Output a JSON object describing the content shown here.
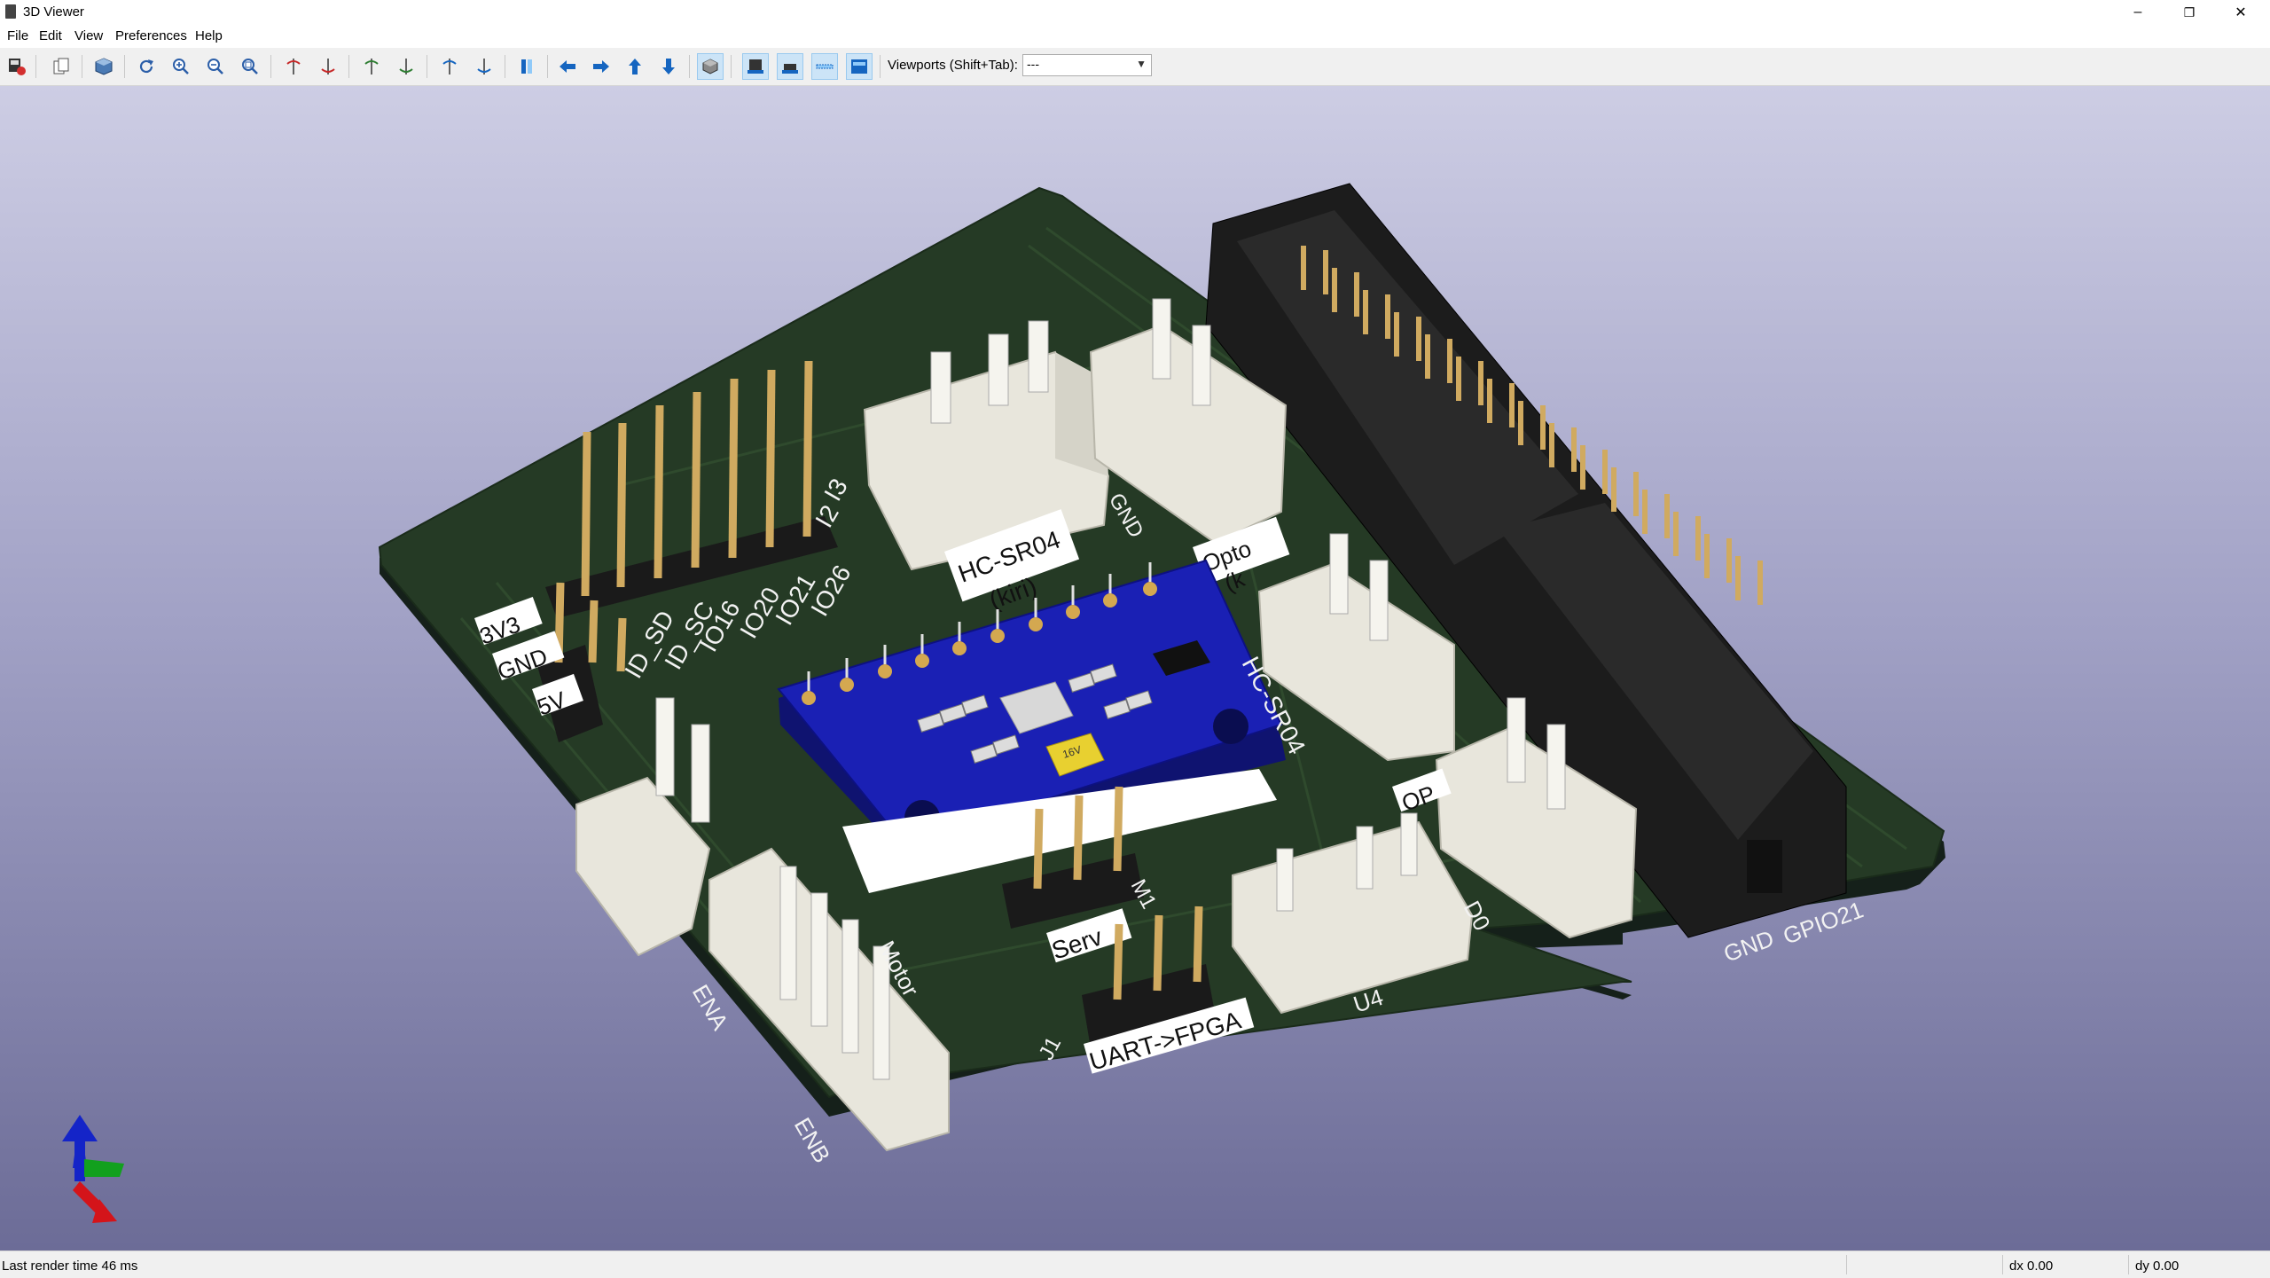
{
  "window": {
    "title": "3D Viewer",
    "controls": {
      "minimize": "–",
      "maximize": "❐",
      "close": "✕"
    }
  },
  "menu": {
    "items": [
      "File",
      "Edit",
      "View",
      "Preferences",
      "Help"
    ]
  },
  "toolbar": {
    "viewports_label": "Viewports (Shift+Tab):",
    "viewports_selected": "---",
    "icons": [
      "render-export-icon",
      "copy-image-icon",
      "raytrace-icon",
      "reload-icon",
      "zoom-in-icon",
      "zoom-out-icon",
      "zoom-fit-icon",
      "rotate-x-cw-icon",
      "rotate-x-ccw-icon",
      "rotate-y-cw-icon",
      "rotate-y-ccw-icon",
      "rotate-z-cw-icon",
      "rotate-z-ccw-icon",
      "flip-board-icon",
      "move-left-icon",
      "move-right-icon",
      "move-up-icon",
      "move-down-icon",
      "ortho-toggle-icon",
      "view-top-icon",
      "view-bottom-icon",
      "view-side-icon",
      "view-front-icon"
    ]
  },
  "board": {
    "header_labels": [
      "I2",
      "I3",
      "IO26",
      "IO21",
      "IO20",
      "IO16",
      "ID_SC",
      "ID_SD"
    ],
    "power_labels": [
      "3V3",
      "GND",
      "5V"
    ],
    "sensor_labels": [
      "HC-SR04",
      "(kiri)",
      "GND",
      "DO",
      "Opto",
      "(k"
    ],
    "right_sensor_label": "HC-SR04",
    "bottom_labels": [
      "Serv",
      "M1",
      "Motor",
      "ENA",
      "ENB",
      "UART->FPGA",
      "J1",
      "U4",
      "GND",
      "GPIO21",
      "D0",
      "OP"
    ],
    "cap_label": "16V"
  },
  "status": {
    "render_time": "Last render time 46 ms",
    "dx": "dx 0.00",
    "dy": "dy 0.00"
  },
  "colors": {
    "pcb": "#253a25",
    "pcb_edge": "#15201a",
    "silkscreen": "#f2f2f2",
    "module_pcb": "#1a20b4",
    "connector": "#e8e6dc",
    "pin": "#d0aa60",
    "idc_header": "#1c1c1c",
    "capacitor": "#e8d030"
  }
}
